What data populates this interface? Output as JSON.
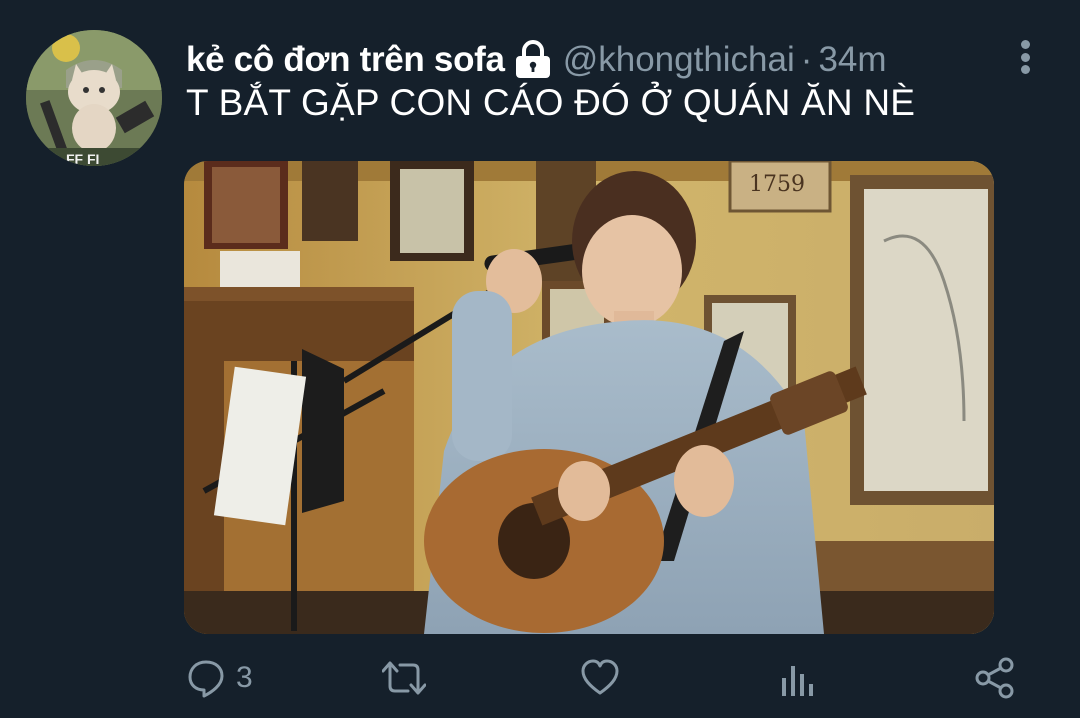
{
  "tweet": {
    "display_name": "kẻ cô đơn trên sofa",
    "handle": "@khongthichai",
    "separator": "·",
    "time": "34m",
    "text": "T BẮT GẶP CON CÁO ĐÓ Ở QUÁN ĂN NÈ",
    "avatar_text": "FF FI",
    "media_sign": "1759"
  },
  "actions": {
    "reply_count": "3",
    "retweet_count": "",
    "like_count": ""
  },
  "colors": {
    "background": "#15202b",
    "primary_text": "#ffffff",
    "secondary_text": "#8899a6"
  },
  "icons": [
    "lock-icon",
    "more-icon",
    "reply-icon",
    "retweet-icon",
    "like-icon",
    "analytics-icon",
    "share-icon"
  ]
}
